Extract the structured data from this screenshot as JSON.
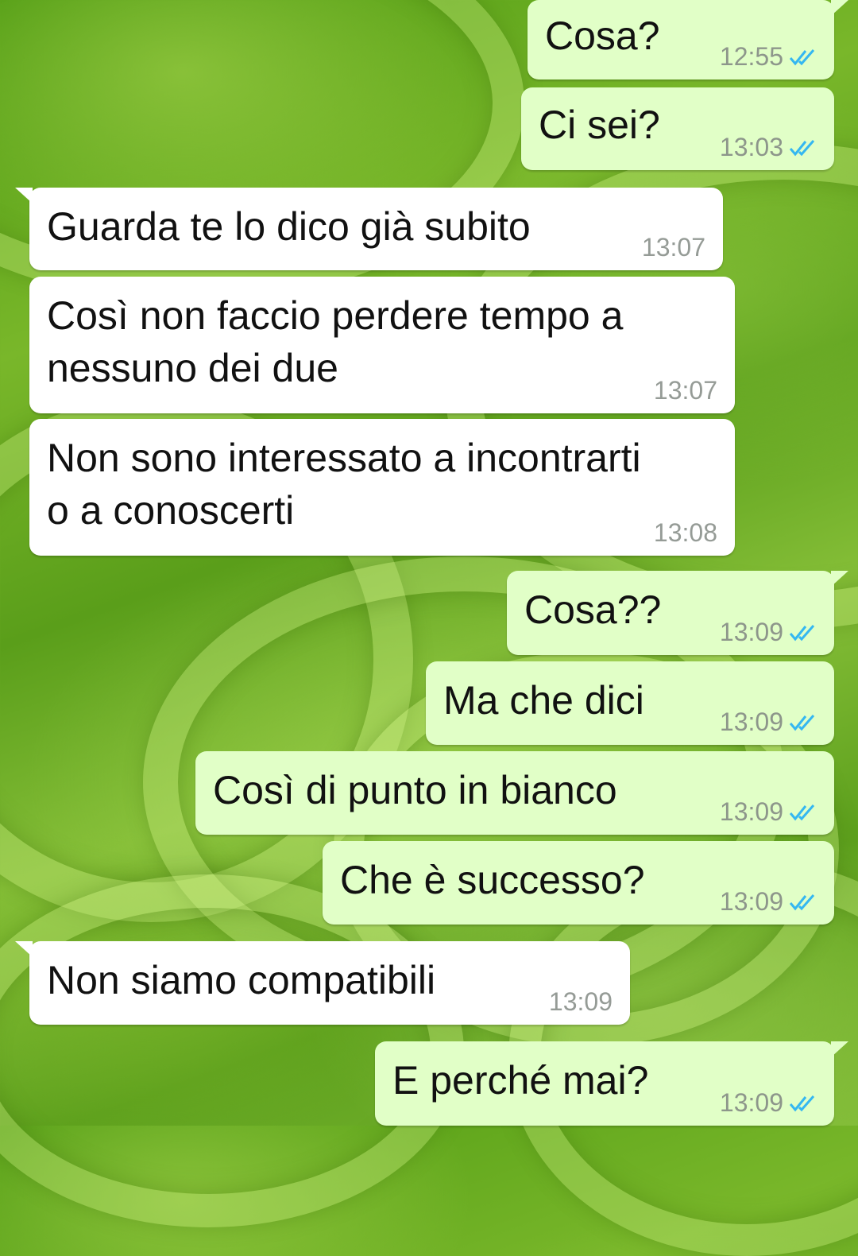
{
  "chat": {
    "messages": [
      {
        "text": "Cosa?",
        "time": "12:55"
      },
      {
        "text": "Ci sei?",
        "time": "13:03"
      },
      {
        "text": "Guarda te lo dico già subito",
        "time": "13:07"
      },
      {
        "line1": "Così non faccio perdere tempo a",
        "line2": "nessuno dei due",
        "time": "13:07"
      },
      {
        "line1": "Non sono interessato a incontrarti",
        "line2": "o a conoscerti",
        "time": "13:08"
      },
      {
        "text": "Cosa??",
        "time": "13:09"
      },
      {
        "text": "Ma che dici",
        "time": "13:09"
      },
      {
        "text": "Così di punto in bianco",
        "time": "13:09"
      },
      {
        "text": "Che è successo?",
        "time": "13:09"
      },
      {
        "text": "Non siamo compatibili",
        "time": "13:09"
      },
      {
        "text": "E perché mai?",
        "time": "13:09"
      }
    ],
    "read_receipt_icon": "double-check-icon",
    "colors": {
      "outgoing_bubble": "#e1ffc7",
      "incoming_bubble": "#ffffff",
      "read_tick": "#34b7f1",
      "timestamp": "#8d968b"
    }
  }
}
